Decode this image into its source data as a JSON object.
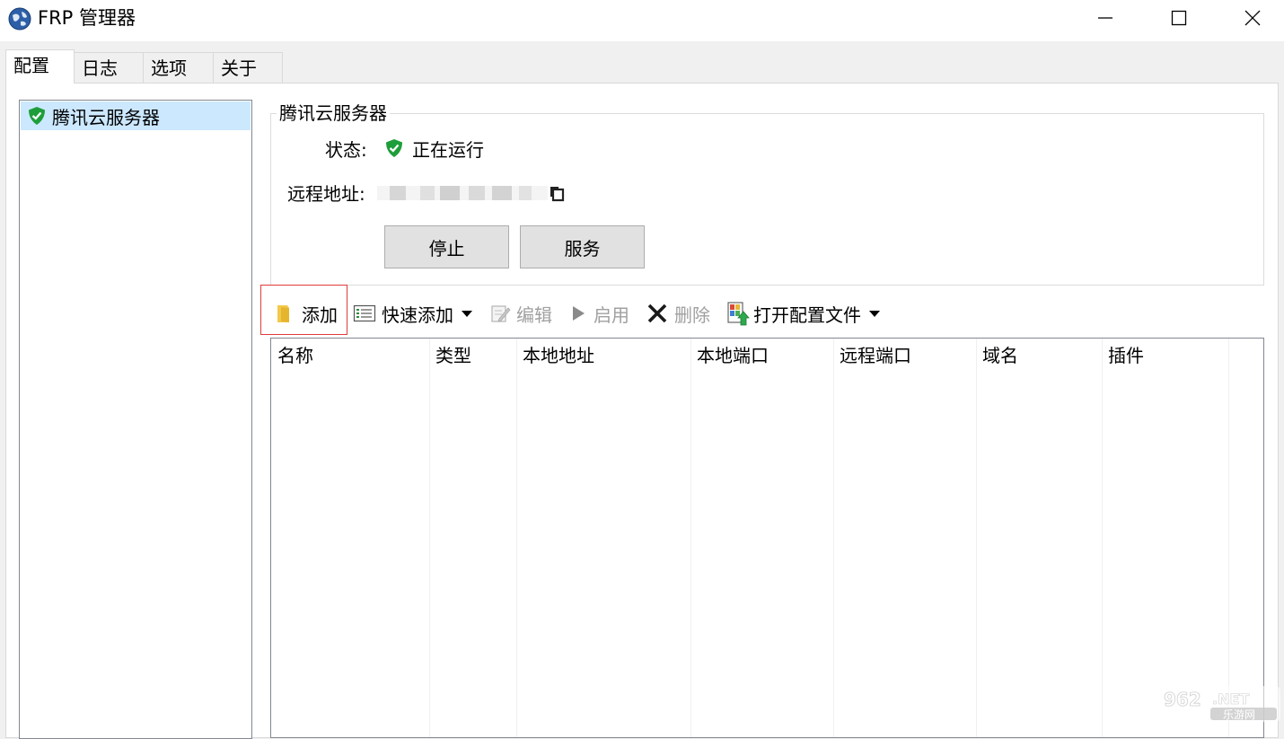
{
  "window": {
    "title": "FRP 管理器"
  },
  "tabs": [
    {
      "label": "配置",
      "active": true
    },
    {
      "label": "日志",
      "active": false
    },
    {
      "label": "选项",
      "active": false
    },
    {
      "label": "关于",
      "active": false
    }
  ],
  "server_list": [
    {
      "label": "腾讯云服务器",
      "status": "running"
    }
  ],
  "detail": {
    "group_title": "腾讯云服务器",
    "status_label": "状态:",
    "status_value": "正在运行",
    "remote_label": "远程地址:",
    "stop_button": "停止",
    "service_button": "服务"
  },
  "toolbar": {
    "add": "添加",
    "quick_add": "快速添加",
    "edit": "编辑",
    "enable": "启用",
    "delete": "删除",
    "open_config": "打开配置文件"
  },
  "table": {
    "columns": [
      "名称",
      "类型",
      "本地地址",
      "本地端口",
      "远程端口",
      "域名",
      "插件"
    ],
    "rows": []
  },
  "watermark": {
    "text_top": "962.NET",
    "text_bottom": "乐游网"
  },
  "colors": {
    "selection": "#cce8ff",
    "shield_green": "#1e9e3a",
    "highlight": "#e03c3c"
  }
}
